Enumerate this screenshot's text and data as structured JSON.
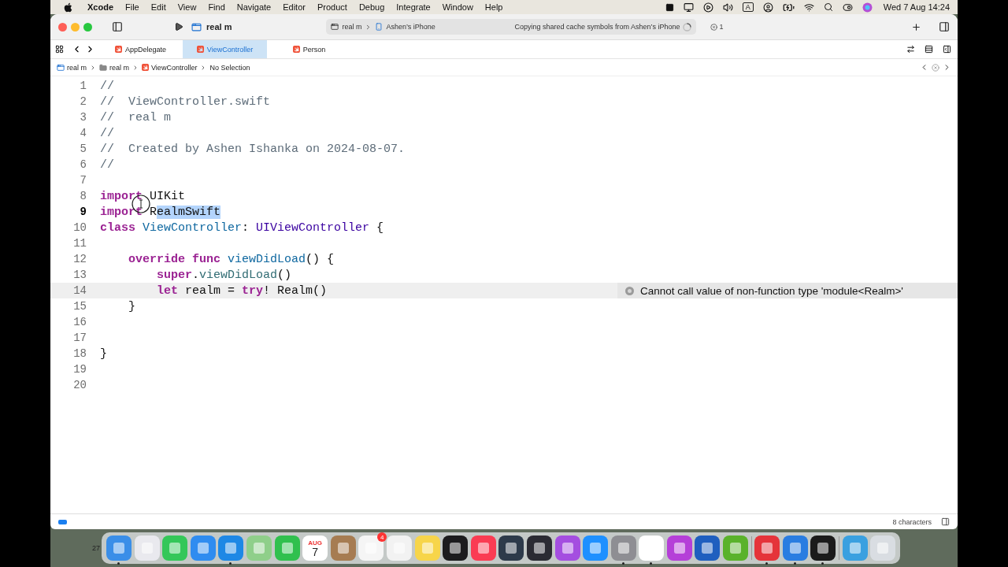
{
  "menu_bar": {
    "app": "Xcode",
    "items": [
      "File",
      "Edit",
      "View",
      "Find",
      "Navigate",
      "Editor",
      "Product",
      "Debug",
      "Integrate",
      "Window",
      "Help"
    ],
    "input_source": "A",
    "clock": "Wed 7 Aug  14:24"
  },
  "toolbar": {
    "project": "real m",
    "scheme": {
      "target": "real m",
      "device": "Ashen’s iPhone"
    },
    "activity": "Copying shared cache symbols from Ashen’s iPhone",
    "error_count": "1"
  },
  "tabs": [
    {
      "label": "AppDelegate",
      "selected": false
    },
    {
      "label": "ViewController",
      "selected": true
    },
    {
      "label": "Person",
      "selected": false
    }
  ],
  "jump_bar": [
    {
      "label": "real m",
      "kind": "project"
    },
    {
      "label": "real m",
      "kind": "folder"
    },
    {
      "label": "ViewController",
      "kind": "swift"
    },
    {
      "label": "No Selection",
      "kind": "plain"
    }
  ],
  "code": [
    {
      "number": "1",
      "tokens": [
        {
          "text": "//",
          "kind": "comment"
        }
      ]
    },
    {
      "number": "2",
      "tokens": [
        {
          "text": "//  ViewController.swift",
          "kind": "comment"
        }
      ]
    },
    {
      "number": "3",
      "tokens": [
        {
          "text": "//  real m",
          "kind": "comment"
        }
      ]
    },
    {
      "number": "4",
      "tokens": [
        {
          "text": "//",
          "kind": "comment"
        }
      ]
    },
    {
      "number": "5",
      "tokens": [
        {
          "text": "//  Created by Ashen Ishanka on 2024-08-07.",
          "kind": "comment"
        }
      ]
    },
    {
      "number": "6",
      "tokens": [
        {
          "text": "//",
          "kind": "comment"
        }
      ]
    },
    {
      "number": "7"
    },
    {
      "number": "8",
      "tokens": [
        {
          "text": "import",
          "kind": "keyword"
        },
        {
          "text": " UIKit",
          "kind": "plain"
        }
      ]
    },
    {
      "number": "9",
      "cursor": true,
      "tokens": [
        {
          "text": "import",
          "kind": "keyword"
        },
        {
          "text": " R",
          "kind": "plain"
        },
        {
          "text": "ealmSwift",
          "kind": "plain",
          "selected": true
        }
      ]
    },
    {
      "number": "10",
      "cursor": false,
      "tokens": [
        {
          "text": "class ",
          "kind": "keyword"
        },
        {
          "text": "ViewController",
          "kind": "decl"
        },
        {
          "text": ": ",
          "kind": "plain"
        },
        {
          "text": "UIViewController",
          "kind": "type"
        },
        {
          "text": " {",
          "kind": "plain"
        }
      ]
    },
    {
      "number": "11"
    },
    {
      "number": "12",
      "tokens": [
        {
          "text": "    override ",
          "kind": "keyword"
        },
        {
          "text": "func ",
          "kind": "keyword"
        },
        {
          "text": "viewDidLoad",
          "kind": "decl"
        },
        {
          "text": "() {",
          "kind": "plain"
        }
      ]
    },
    {
      "number": "13",
      "tokens": [
        {
          "text": "        super",
          "kind": "keyword"
        },
        {
          "text": ".",
          "kind": "plain"
        },
        {
          "text": "viewDidLoad",
          "kind": "call"
        },
        {
          "text": "()",
          "kind": "plain"
        }
      ]
    },
    {
      "number": "14",
      "highlighted": true,
      "error": "Cannot call value of non-function type 'module<Realm>'",
      "tokens": [
        {
          "text": "        let",
          "kind": "keyword"
        },
        {
          "text": " realm = ",
          "kind": "plain"
        },
        {
          "text": "try",
          "kind": "keyword"
        },
        {
          "text": "! Realm()",
          "kind": "plain"
        }
      ]
    },
    {
      "number": "15",
      "highlighted": false,
      "tokens": [
        {
          "text": "    }",
          "kind": "plain"
        }
      ]
    },
    {
      "number": "16"
    },
    {
      "number": "17"
    },
    {
      "number": "18",
      "tokens": [
        {
          "text": "}",
          "kind": "plain"
        }
      ]
    },
    {
      "number": "19"
    },
    {
      "number": "20"
    }
  ],
  "status_bar": {
    "selection": "8 characters"
  },
  "desktop_text": "27",
  "dock": {
    "groups": [
      [
        {
          "color": "#3a8ee8",
          "running": true
        },
        {
          "color": "#e9e9ee",
          "running": false
        },
        {
          "color": "#34c759",
          "running": false
        },
        {
          "color": "#2f8cf0",
          "running": false
        },
        {
          "color": "#1e88e5",
          "running": true
        },
        {
          "color": "#8fcf8a",
          "running": false
        },
        {
          "color": "#30c04e",
          "running": false
        },
        {
          "color": "#ffffff",
          "running": false,
          "month": "AUG",
          "day": "7"
        },
        {
          "color": "#a67c52",
          "running": false
        },
        {
          "color": "#f5f5f5",
          "running": false,
          "badge": "4"
        },
        {
          "color": "#f2f2f2",
          "running": false
        },
        {
          "color": "#f7d54a",
          "running": false
        },
        {
          "color": "#1c1c1e",
          "running": false
        },
        {
          "color": "#fa3c53",
          "running": false
        },
        {
          "color": "#2d3a4a",
          "running": false
        },
        {
          "color": "#2b2b33",
          "running": false
        },
        {
          "color": "#a44ee0",
          "running": false
        },
        {
          "color": "#1e90ff",
          "running": false
        },
        {
          "color": "#8e8e93",
          "running": true
        },
        {
          "color": "#ffffff",
          "running": true
        },
        {
          "color": "#b53fd8",
          "running": false
        },
        {
          "color": "#1f5fbf",
          "running": false
        },
        {
          "color": "#5ab22b",
          "running": false
        }
      ],
      [
        {
          "color": "#e5343a",
          "running": true
        },
        {
          "color": "#2a7de1",
          "running": true
        },
        {
          "color": "#1b1b1b",
          "running": true
        }
      ],
      [
        {
          "color": "#3aa0e0",
          "running": false
        },
        {
          "color": "#d9dde2",
          "running": false
        }
      ]
    ]
  }
}
